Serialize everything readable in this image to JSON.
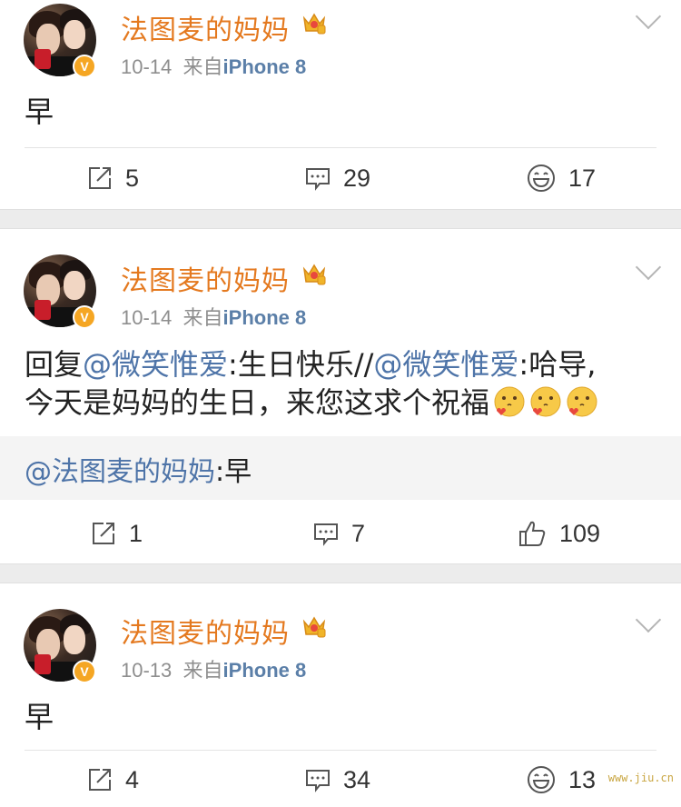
{
  "posts": [
    {
      "author": "法图麦的妈妈",
      "date": "10-14",
      "source_prefix": "来自",
      "source_device": "iPhone 8",
      "text": "早",
      "repost_count": "5",
      "comment_count": "29",
      "like_count": "17",
      "like_icon": "laugh-icon"
    },
    {
      "author": "法图麦的妈妈",
      "date": "10-14",
      "source_prefix": "来自",
      "source_device": "iPhone 8",
      "text_parts": {
        "p1": "回复",
        "m1": "@微笑惟爱",
        "p2": ":生日快乐//",
        "m2": "@微笑惟爱",
        "p3": ":哈导,",
        "line2": "今天是妈妈的生日，来您这求个祝福"
      },
      "quote": {
        "mention": "@法图麦的妈妈",
        "text": ":早"
      },
      "repost_count": "1",
      "comment_count": "7",
      "like_count": "109",
      "like_icon": "thumbs-up-icon"
    },
    {
      "author": "法图麦的妈妈",
      "date": "10-13",
      "source_prefix": "来自",
      "source_device": "iPhone 8",
      "text": "早",
      "repost_count": "4",
      "comment_count": "34",
      "like_count": "13",
      "like_icon": "laugh-icon"
    }
  ],
  "watermark": "www.jiu.cn",
  "colors": {
    "name": "#e4791f",
    "mention": "#4e74a8",
    "badge": "#f5a623",
    "separator": "#ececec"
  }
}
